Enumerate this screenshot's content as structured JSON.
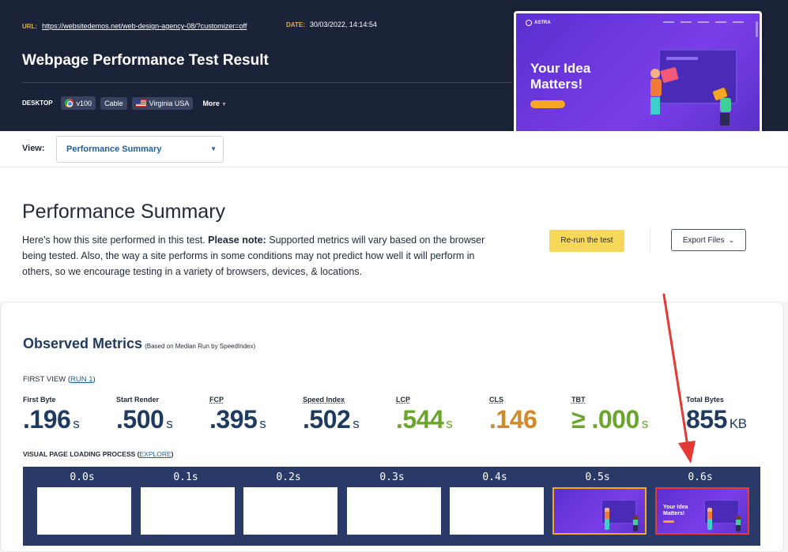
{
  "header": {
    "url_label": "URL:",
    "url": "https://websitedemos.net/web-design-agency-08/?customizer=off",
    "date_label": "DATE:",
    "date": "30/03/2022, 14:14:54",
    "title": "Webpage Performance Test Result",
    "device": "DESKTOP",
    "browser_version": "v100",
    "connection": "Cable",
    "location": "Virginia USA",
    "more_label": "More"
  },
  "preview": {
    "brand": "ASTRA",
    "headline": "Your Idea Matters!",
    "icons": [
      "astra-logo-icon",
      "hamburger-icon"
    ]
  },
  "view": {
    "label": "View:",
    "selected": "Performance Summary"
  },
  "summary": {
    "heading": "Performance Summary",
    "intro": "Here's how this site performed in this test. ",
    "note_bold": "Please note:",
    "note_text": " Supported metrics will vary based on the browser being tested. Also, the way a site performs in some conditions may not predict how well it will perform in others, so we encourage testing in a variety of browsers, devices, & locations.",
    "rerun_label": "Re-run the test",
    "export_label": "Export Files"
  },
  "metrics": {
    "heading": "Observed Metrics",
    "subheading": "(Based on Median Run by SpeedIndex)",
    "first_view_prefix": "FIRST VIEW (",
    "first_view_link": "RUN 1",
    "first_view_suffix": ")",
    "items": [
      {
        "label": "First Byte",
        "value": ".196",
        "unit": "s",
        "status": "neutral"
      },
      {
        "label": "Start Render",
        "value": ".500",
        "unit": "s",
        "status": "neutral"
      },
      {
        "label": "FCP",
        "value": ".395",
        "unit": "s",
        "status": "neutral"
      },
      {
        "label": "Speed Index",
        "value": ".502",
        "unit": "s",
        "status": "neutral"
      },
      {
        "label": "LCP",
        "value": ".544",
        "unit": "s",
        "status": "good"
      },
      {
        "label": "CLS",
        "value": ".146",
        "unit": "",
        "status": "warning"
      },
      {
        "label": "TBT",
        "value": "≥ .000",
        "unit": "s",
        "status": "good"
      },
      {
        "label": "Total Bytes",
        "value": "855",
        "unit": "KB",
        "status": "neutral"
      }
    ],
    "loading_label": "VISUAL PAGE LOADING PROCESS (",
    "loading_link": "EXPLORE",
    "loading_suffix": ")"
  },
  "filmstrip": {
    "frames": [
      {
        "time": "0.0s",
        "state": "blank"
      },
      {
        "time": "0.1s",
        "state": "blank"
      },
      {
        "time": "0.2s",
        "state": "blank"
      },
      {
        "time": "0.3s",
        "state": "blank"
      },
      {
        "time": "0.4s",
        "state": "blank"
      },
      {
        "time": "0.5s",
        "state": "partial"
      },
      {
        "time": "0.6s",
        "state": "complete"
      }
    ],
    "mini_headline": "Your Idea Matters!"
  },
  "colors": {
    "header_bg": "#1b2338",
    "accent_yellow": "#f7d85a",
    "metric_blue": "#1f3a5f",
    "good_green": "#6aa62e",
    "warn_orange": "#d08a2a",
    "filmstrip_bg": "#2a3a68",
    "highlight_red": "#e53935"
  }
}
